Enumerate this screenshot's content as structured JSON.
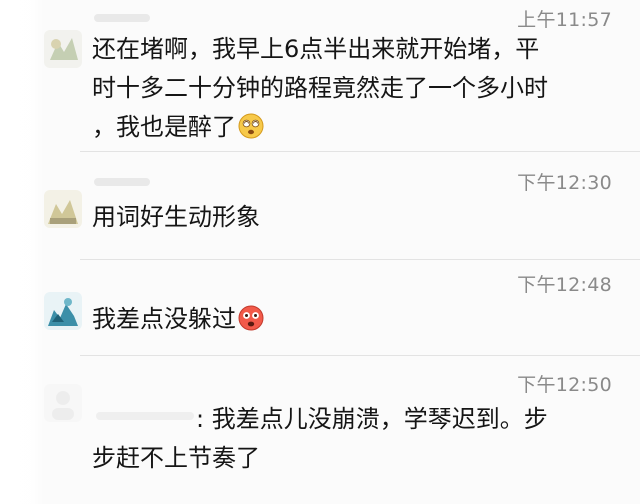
{
  "comments": [
    {
      "time": "上午11:57",
      "lines": [
        "还在堵啊，我早上6点半出来就开始堵，平",
        "时十多二十分钟的路程竟然走了一个多小时",
        "，我也是醉了"
      ],
      "emoji": "dizzy-face-emoji"
    },
    {
      "time": "下午12:30",
      "lines": [
        "用词好生动形象"
      ]
    },
    {
      "time": "下午12:48",
      "lines": [
        "我差点没躲过"
      ],
      "emoji": "flushed-face-emoji"
    },
    {
      "time": "下午12:50",
      "lines": [
        ": 我差点儿没崩溃，学琴迟到。步",
        "步赶不上节奏了"
      ]
    }
  ]
}
